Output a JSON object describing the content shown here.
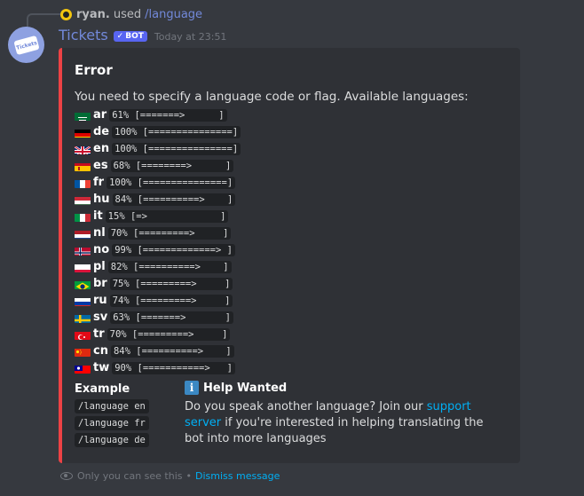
{
  "reply": {
    "username": "ryan.",
    "text": "used",
    "command": "/language"
  },
  "message": {
    "username": "Tickets",
    "badge": "BOT",
    "badge_check": "✓",
    "timestamp": "Today at 23:51",
    "avatar_text": "Tickets"
  },
  "embed": {
    "accent_color": "#ed4245",
    "title": "Error",
    "description": "You need to specify a language code or flag. Available languages:",
    "languages": [
      {
        "flag": "sa",
        "code": "ar",
        "progress": "61% [=======>      ]"
      },
      {
        "flag": "de",
        "code": "de",
        "progress": "100% [===============]"
      },
      {
        "flag": "gb",
        "code": "en",
        "progress": "100% [===============]"
      },
      {
        "flag": "es",
        "code": "es",
        "progress": "68% [========>      ]"
      },
      {
        "flag": "fr",
        "code": "fr",
        "progress": "100% [===============]"
      },
      {
        "flag": "hu",
        "code": "hu",
        "progress": "84% [==========>    ]"
      },
      {
        "flag": "it",
        "code": "it",
        "progress": "15% [=>             ]"
      },
      {
        "flag": "nl",
        "code": "nl",
        "progress": "70% [=========>     ]"
      },
      {
        "flag": "no",
        "code": "no",
        "progress": "99% [=============> ]"
      },
      {
        "flag": "pl",
        "code": "pl",
        "progress": "82% [==========>    ]"
      },
      {
        "flag": "br",
        "code": "br",
        "progress": "75% [=========>     ]"
      },
      {
        "flag": "ru",
        "code": "ru",
        "progress": "74% [=========>     ]"
      },
      {
        "flag": "se",
        "code": "sv",
        "progress": "63% [=======>       ]"
      },
      {
        "flag": "tr",
        "code": "tr",
        "progress": "70% [=========>     ]"
      },
      {
        "flag": "cn",
        "code": "cn",
        "progress": "84% [==========>    ]"
      },
      {
        "flag": "tw",
        "code": "tw",
        "progress": "90% [===========>   ]"
      }
    ],
    "example_title": "Example",
    "examples": [
      "/language en",
      "/language fr",
      "/language de"
    ],
    "help_title": "Help Wanted",
    "help_icon": "i",
    "help_text_before": "Do you speak another language? Join our ",
    "help_link": "support server",
    "help_text_after": " if you're interested in helping translating the bot into more languages"
  },
  "footer": {
    "notice": "Only you can see this",
    "separator": "•",
    "dismiss": "Dismiss message"
  }
}
